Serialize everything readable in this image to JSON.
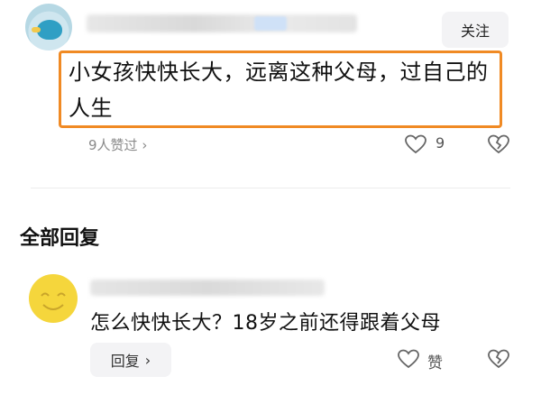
{
  "main_comment": {
    "follow_label": "关注",
    "text": "小女孩快快长大，远离这种父母，过自己的人生",
    "liked_by": "9人赞过",
    "like_count": "9",
    "highlight_color": "#f08a24"
  },
  "replies_section": {
    "title": "全部回复"
  },
  "reply": {
    "text": "怎么快快长大？18岁之前还得跟着父母",
    "reply_label": "回复",
    "like_label": "赞"
  },
  "icons": {
    "chevron": "chevron-right-icon",
    "heart": "heart-icon",
    "dislike": "broken-heart-icon"
  }
}
